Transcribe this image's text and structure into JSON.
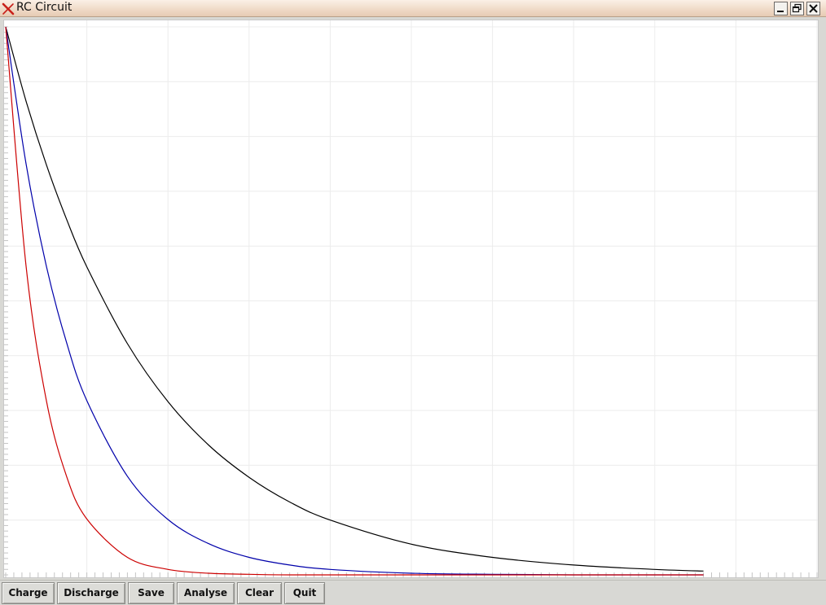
{
  "window": {
    "title": "RC Circuit",
    "app_icon": "x-logo-icon",
    "controls": [
      "minimize-icon",
      "maximize-icon",
      "close-icon"
    ]
  },
  "toolbar": {
    "buttons": [
      {
        "label": "Charge"
      },
      {
        "label": "Discharge"
      },
      {
        "label": "Save"
      },
      {
        "label": "Analyse"
      },
      {
        "label": "Clear"
      },
      {
        "label": "Quit"
      }
    ]
  },
  "chart_data": {
    "type": "line",
    "title": "",
    "xlabel": "",
    "ylabel": "",
    "xlim": [
      0,
      10
    ],
    "ylim": [
      0,
      1
    ],
    "grid": true,
    "legend": "none",
    "x": [
      0,
      0.25,
      0.5,
      0.75,
      1,
      1.5,
      2,
      2.5,
      3,
      3.5,
      4,
      5,
      6,
      7,
      8,
      8.6
    ],
    "series": [
      {
        "color": "#000000",
        "values": [
          1.0,
          0.865,
          0.749,
          0.649,
          0.562,
          0.422,
          0.316,
          0.237,
          0.178,
          0.133,
          0.1,
          0.056,
          0.032,
          0.018,
          0.01,
          0.007
        ]
      },
      {
        "color": "#0000aa",
        "values": [
          1.0,
          0.751,
          0.564,
          0.424,
          0.318,
          0.18,
          0.101,
          0.057,
          0.032,
          0.018,
          0.01,
          0.003,
          0.001,
          0.0,
          0.0,
          0.0
        ]
      },
      {
        "color": "#cc0000",
        "values": [
          1.0,
          0.565,
          0.319,
          0.18,
          0.102,
          0.032,
          0.01,
          0.003,
          0.001,
          0.0,
          0.0,
          0.0,
          0.0,
          0.0,
          0.0,
          0.0
        ]
      }
    ]
  }
}
